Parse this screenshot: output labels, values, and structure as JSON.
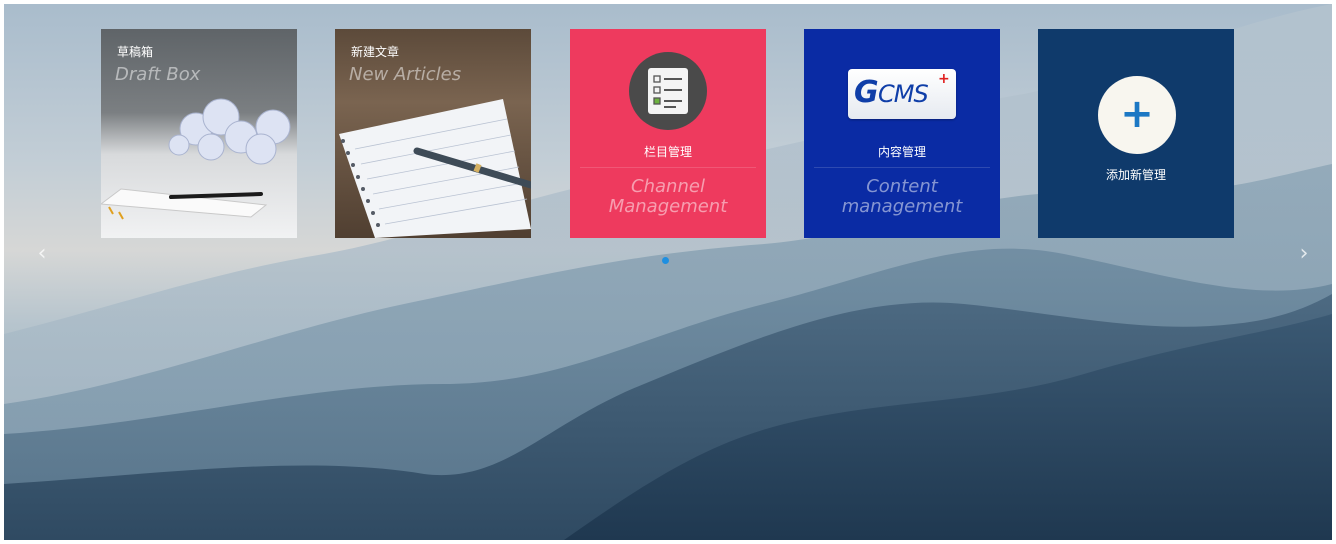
{
  "tiles": {
    "draft": {
      "title_cn": "草稿箱",
      "title_en": "Draft Box"
    },
    "new_article": {
      "title_cn": "新建文章",
      "title_en": "New Articles"
    },
    "channel": {
      "title_cn": "栏目管理",
      "title_en": "Channel Management"
    },
    "content": {
      "title_cn": "内容管理",
      "title_en": "Content management",
      "logo_mark": "G",
      "logo_text": "CMS",
      "logo_sup": "+"
    },
    "add": {
      "title_cn": "添加新管理",
      "icon_glyph": "+"
    }
  },
  "carousel": {
    "prev_glyph": "‹",
    "next_glyph": "›",
    "pages": 1,
    "active_page": 1
  },
  "colors": {
    "channel_tile": "#ee3a5e",
    "content_tile": "#0a2ba4",
    "add_tile": "#0f3a6b",
    "indicator": "#1f8fe0"
  },
  "icons": {
    "channel": "checklist-icon",
    "add": "plus-icon",
    "prev": "chevron-left-icon",
    "next": "chevron-right-icon"
  }
}
